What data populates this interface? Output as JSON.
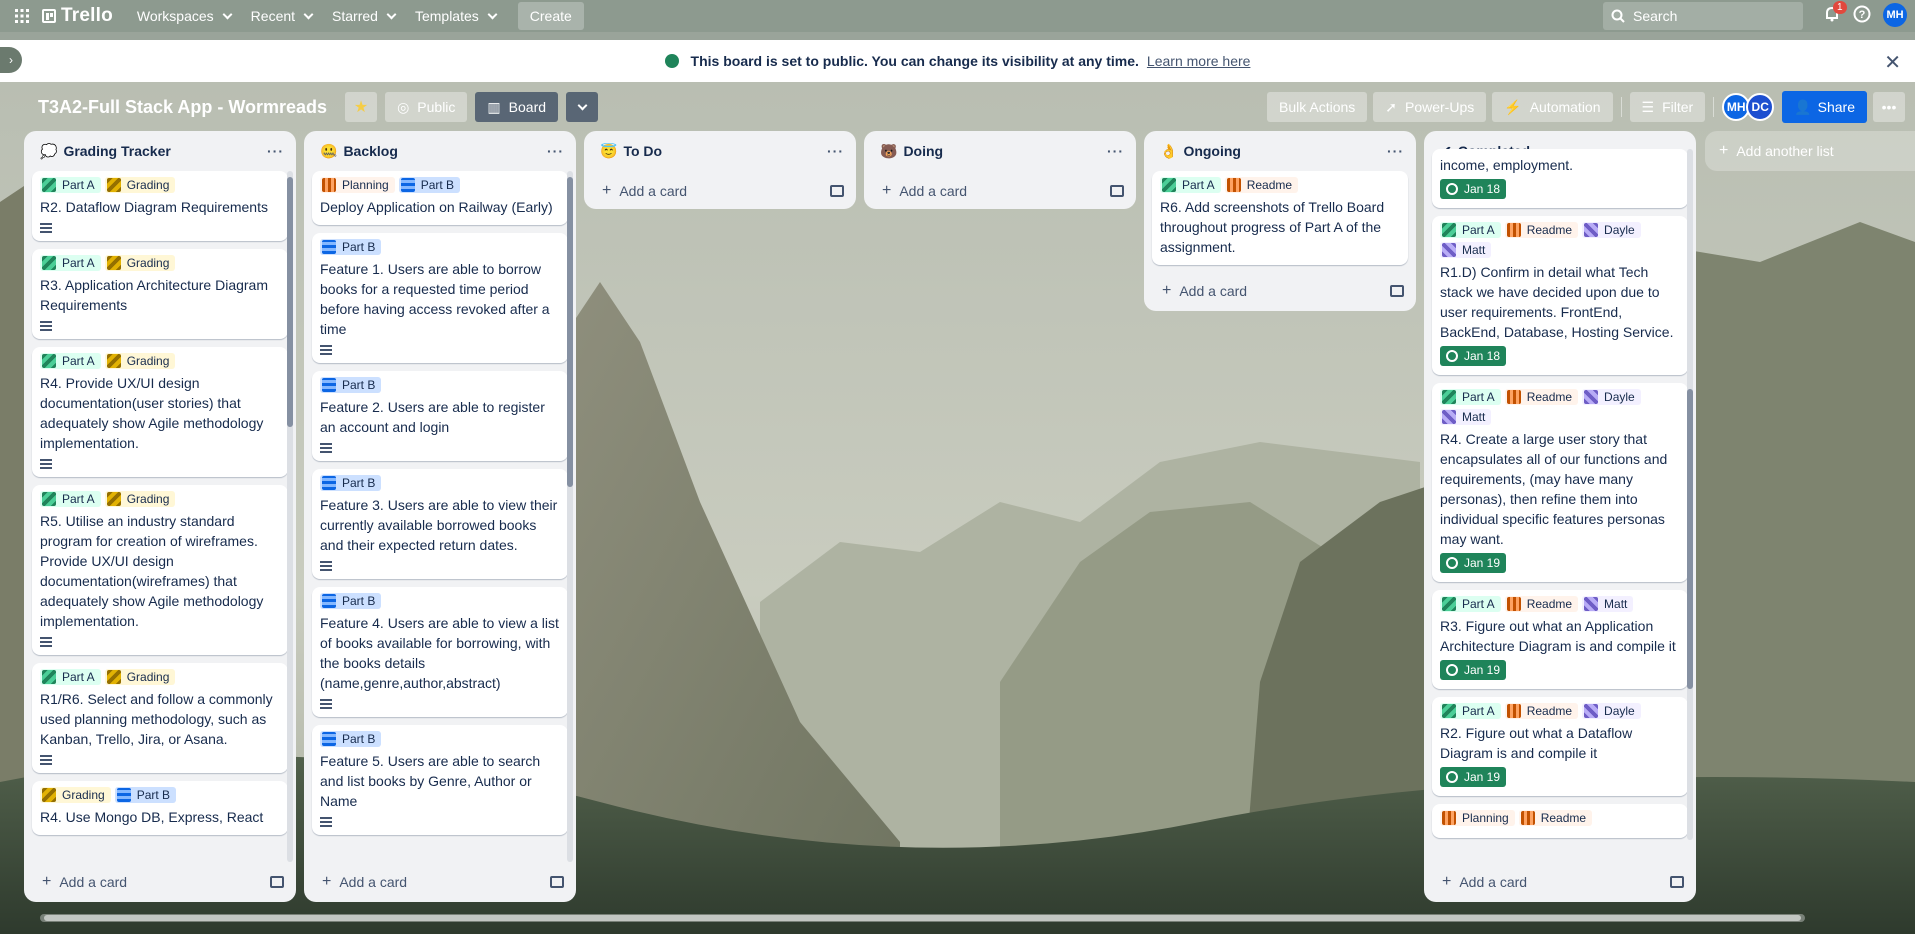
{
  "nav": {
    "brand": "Trello",
    "menus": [
      "Workspaces",
      "Recent",
      "Starred",
      "Templates"
    ],
    "create": "Create",
    "search_placeholder": "Search",
    "notification_count": "1",
    "user_initials": "MH"
  },
  "banner": {
    "text": "This board is set to public. You can change its visibility at any time.",
    "link": "Learn more here"
  },
  "board": {
    "title": "T3A2-Full Stack App - Wormreads",
    "visibility": "Public",
    "view": "Board",
    "actions": [
      "Bulk Actions",
      "Power-Ups",
      "Automation",
      "Filter"
    ],
    "members": [
      {
        "initials": "MH",
        "color": "#0c66e4"
      },
      {
        "initials": "DC",
        "color": "#1d4fd0"
      }
    ],
    "share": "Share",
    "add_list": "Add another list"
  },
  "lists": [
    {
      "title": "Grading Tracker",
      "emoji": "💭",
      "add": "Add a card",
      "cards": [
        {
          "labels": [
            {
              "t": "Part A",
              "c": "partA"
            },
            {
              "t": "Grading",
              "c": "grading"
            }
          ],
          "text": "R2. Dataflow Diagram Requirements",
          "desc": true
        },
        {
          "labels": [
            {
              "t": "Part A",
              "c": "partA"
            },
            {
              "t": "Grading",
              "c": "grading"
            }
          ],
          "text": "R3. Application Architecture Diagram Requirements",
          "desc": true
        },
        {
          "labels": [
            {
              "t": "Part A",
              "c": "partA"
            },
            {
              "t": "Grading",
              "c": "grading"
            }
          ],
          "text": "R4. Provide UX/UI design documentation(user stories) that adequately show Agile methodology implementation.",
          "desc": true
        },
        {
          "labels": [
            {
              "t": "Part A",
              "c": "partA"
            },
            {
              "t": "Grading",
              "c": "grading"
            }
          ],
          "text": "R5. Utilise an industry standard program for creation of wireframes. Provide UX/UI design documentation(wireframes) that adequately show Agile methodology implementation.",
          "desc": true
        },
        {
          "labels": [
            {
              "t": "Part A",
              "c": "partA"
            },
            {
              "t": "Grading",
              "c": "grading"
            }
          ],
          "text": "R1/R6. Select and follow a commonly used planning methodology, such as Kanban, Trello, Jira, or Asana.",
          "desc": true
        },
        {
          "labels": [
            {
              "t": "Grading",
              "c": "grading"
            },
            {
              "t": "Part B",
              "c": "partB"
            }
          ],
          "text": "R4. Use Mongo DB, Express, React",
          "desc": false
        }
      ]
    },
    {
      "title": "Backlog",
      "emoji": "🤐",
      "add": "Add a card",
      "cards": [
        {
          "labels": [
            {
              "t": "Planning",
              "c": "planning"
            },
            {
              "t": "Part B",
              "c": "partB"
            }
          ],
          "text": "Deploy Application on Railway (Early)",
          "desc": false
        },
        {
          "labels": [
            {
              "t": "Part B",
              "c": "partB"
            }
          ],
          "text": "Feature 1. Users are able to borrow books for a requested time period before having access revoked after a time",
          "desc": true
        },
        {
          "labels": [
            {
              "t": "Part B",
              "c": "partB"
            }
          ],
          "text": "Feature 2. Users are able to register an account and login",
          "desc": true
        },
        {
          "labels": [
            {
              "t": "Part B",
              "c": "partB"
            }
          ],
          "text": "Feature 3. Users are able to view their currently available borrowed books and their expected return dates.",
          "desc": true
        },
        {
          "labels": [
            {
              "t": "Part B",
              "c": "partB"
            }
          ],
          "text": "Feature 4. Users are able to view a list of books available for borrowing, with the books details (name,genre,author,abstract)",
          "desc": true
        },
        {
          "labels": [
            {
              "t": "Part B",
              "c": "partB"
            }
          ],
          "text": "Feature 5. Users are able to search and list books by Genre, Author or Name",
          "desc": true
        }
      ]
    },
    {
      "title": "To Do",
      "emoji": "😇",
      "add": "Add a card",
      "cards": []
    },
    {
      "title": "Doing",
      "emoji": "🐻",
      "add": "Add a card",
      "cards": []
    },
    {
      "title": "Ongoing",
      "emoji": "👌",
      "add": "Add a card",
      "cards": [
        {
          "labels": [
            {
              "t": "Part A",
              "c": "partA"
            },
            {
              "t": "Readme",
              "c": "readme"
            }
          ],
          "text": "R6. Add screenshots of Trello Board throughout progress of Part A of the assignment.",
          "desc": false
        }
      ]
    },
    {
      "title": "Completed",
      "emoji": "✔",
      "add": "Add a card",
      "cards": [
        {
          "labels": [],
          "text": "income, employment.",
          "desc": false,
          "due": "Jan 18"
        },
        {
          "labels": [
            {
              "t": "Part A",
              "c": "partA"
            },
            {
              "t": "Readme",
              "c": "readme"
            },
            {
              "t": "Dayle",
              "c": "dayle"
            },
            {
              "t": "Matt",
              "c": "matt"
            }
          ],
          "text": "R1.D) Confirm in detail what Tech stack we have decided upon due to user requirements. FrontEnd, BackEnd, Database, Hosting Service.",
          "desc": false,
          "due": "Jan 18"
        },
        {
          "labels": [
            {
              "t": "Part A",
              "c": "partA"
            },
            {
              "t": "Readme",
              "c": "readme"
            },
            {
              "t": "Dayle",
              "c": "dayle"
            },
            {
              "t": "Matt",
              "c": "matt"
            }
          ],
          "text": "R4. Create a large user story that encapsulates all of our functions and requirements, (may have many personas), then refine them into individual specific features personas may want.",
          "desc": false,
          "due": "Jan 19"
        },
        {
          "labels": [
            {
              "t": "Part A",
              "c": "partA"
            },
            {
              "t": "Readme",
              "c": "readme"
            },
            {
              "t": "Matt",
              "c": "matt"
            }
          ],
          "text": "R3. Figure out what an Application Architecture Diagram is and compile it",
          "desc": false,
          "due": "Jan 19"
        },
        {
          "labels": [
            {
              "t": "Part A",
              "c": "partA"
            },
            {
              "t": "Readme",
              "c": "readme"
            },
            {
              "t": "Dayle",
              "c": "dayle"
            }
          ],
          "text": "R2. Figure out what a Dataflow Diagram is and compile it",
          "desc": false,
          "due": "Jan 19"
        },
        {
          "labels": [
            {
              "t": "Planning",
              "c": "planning"
            },
            {
              "t": "Readme",
              "c": "readme"
            }
          ],
          "text": "",
          "desc": false
        }
      ]
    }
  ]
}
